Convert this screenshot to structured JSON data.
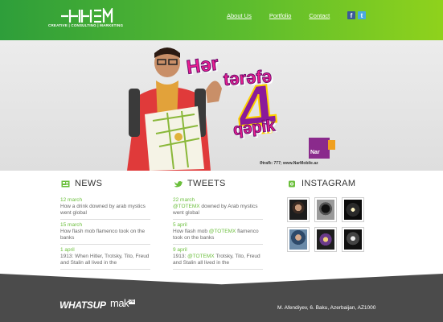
{
  "header": {
    "tagline": "CREATIVE | CONSULTING | MARKETING",
    "nav": [
      "About Us",
      "Portfolio",
      "Contact"
    ],
    "social": [
      {
        "icon": "facebook-icon",
        "glyph": "f"
      },
      {
        "icon": "twitter-icon",
        "glyph": "t"
      }
    ],
    "colors": {
      "gradient_start": "#2e9e3a",
      "gradient_end": "#8fd21c"
    }
  },
  "banner": {
    "headline_line1": "Hər",
    "headline_line2": "tərəfə",
    "headline_number": "4",
    "headline_line3": "qəpik",
    "brand": "Nar",
    "footnote": "Ətraflı: 777; www.NarMobile.az"
  },
  "news": {
    "title": "NEWS",
    "items": [
      {
        "date": "12 march",
        "text": "How a drink downed by arab mystics went global"
      },
      {
        "date": "15 march",
        "text": "How flash mob flamenco took on the banks"
      },
      {
        "date": "1 april",
        "text": "1913: When Hitler, Trotsky, Tito, Freud and Stalin all lived in the"
      }
    ]
  },
  "tweets": {
    "title": "TWEETS",
    "items": [
      {
        "date": "22 march",
        "handle": "@TOTEMX",
        "text": " downed by Arab mystics went global"
      },
      {
        "date": "5 april",
        "pre": "How flash mob ",
        "handle": "@TOTEMX",
        "text": " flamenco took on the banks"
      },
      {
        "date": "9 april",
        "pre": "1913: ",
        "handle": "@TOTEMX",
        "text": " Trotsky, Tito, Freud and Stalin all lived in the"
      }
    ]
  },
  "instagram": {
    "title": "INSTAGRAM"
  },
  "footer": {
    "brand1": "WHATSUP",
    "brand2": "mak",
    "brand2_badge": "PR",
    "address": "M. Afendiyev, 6. Baku, Azerbaijan, AZ1000"
  }
}
